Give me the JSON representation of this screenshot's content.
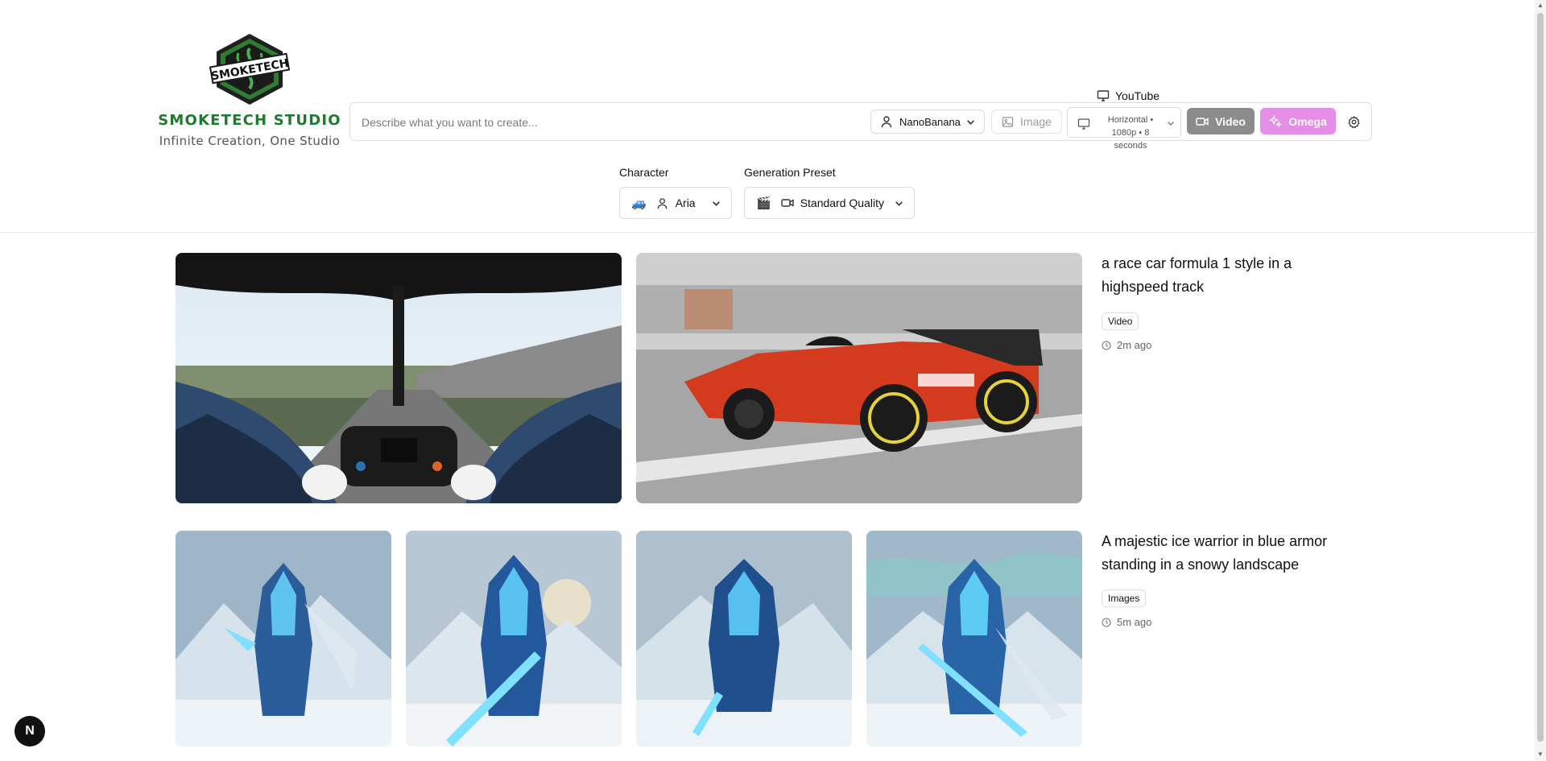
{
  "brand": {
    "logo_text": "SMOKETECH",
    "name": "SMOKETECH STUDIO",
    "tagline": "Infinite Creation, One Studio"
  },
  "platform": {
    "label": "YouTube",
    "icon": "monitor-icon"
  },
  "prompt": {
    "placeholder": "Describe what you want to create...",
    "value": ""
  },
  "toolbar": {
    "model_label": "NanoBanana",
    "image_label": "Image",
    "format_label": "Horizontal • 1080p • 8 seconds",
    "video_label": "Video",
    "omega_label": "Omega",
    "colors": {
      "video_bg": "#8c8c8c",
      "omega_bg": "#e58ee8"
    }
  },
  "character": {
    "label": "Character",
    "emoji": "🚙",
    "value": "Aria"
  },
  "preset": {
    "label": "Generation Preset",
    "emoji": "🎬",
    "value": "Standard Quality"
  },
  "generations": [
    {
      "prompt": "a race car formula 1 style in a highspeed track",
      "type": "Video",
      "time": "2m ago"
    },
    {
      "prompt": "A majestic ice warrior in blue armor standing in a snowy landscape",
      "type": "Images",
      "time": "5m ago"
    }
  ],
  "dev_badge": "N",
  "brand_color": "#1e7a2f"
}
